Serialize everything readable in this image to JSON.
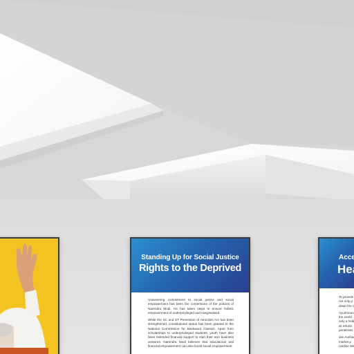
{
  "gallery": {
    "colors": {
      "wall": "#dedfe0",
      "ceiling_light": "#ffffff",
      "frame": "#3a3b3d",
      "poster_blue_start": "#2c8fd0",
      "poster_blue_end": "#2a3f8f",
      "poster_yellow": "#f3c322"
    },
    "left_poster": {
      "figure": "hand-raised-figure"
    },
    "center_poster": {
      "subtitle": "Standing Up for Social Justice",
      "title": "Rights to the Deprived",
      "paragraphs": [
        "Unwavering commitment to social justice and social empowerment has been the cornerstone of the policies of Narendra Modi. He has taken steps to ensure holistic empowerment of underprivileged and marginalised.",
        "While the SC and ST Prevention of Atrocities Act has been strengthened, constitutional status has been granted to the National Commission for Backward Classes. Apart from scholarships to underprivileged students, youth have also been extended financial support to start their own business ventures. Narendra Modi believes that educational and financial empowerment can also boost social empowerment."
      ]
    },
    "right_poster": {
      "subtitle": "Acce",
      "title": "Hea",
      "paragraphs": [
        "To provide\nnot only p\ndown the c",
        "Ayushman\nthe world\nonly a heal\nits refurbi\npenetratio",
        "Jan Aushad\nmarket p\ncardiac ste"
      ]
    }
  }
}
